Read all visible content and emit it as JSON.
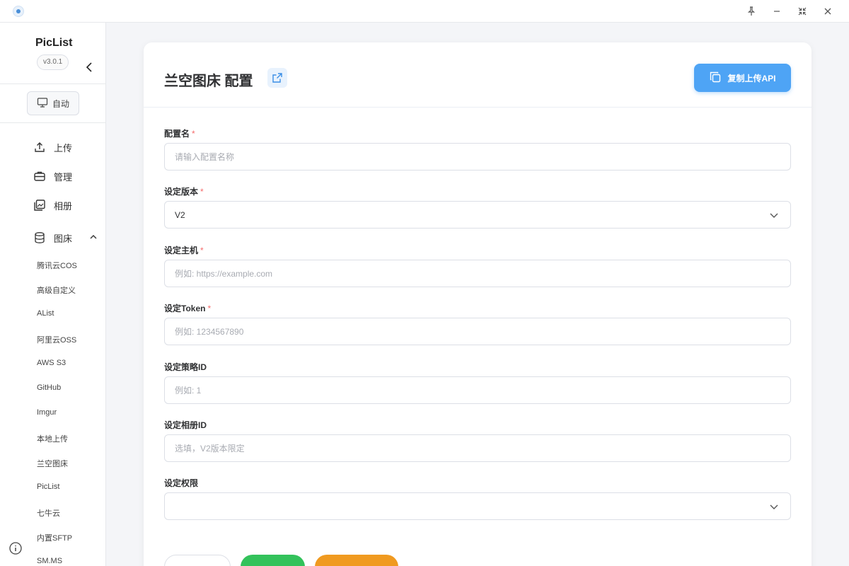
{
  "window": {
    "pin_icon": "pin-icon",
    "minimize_icon": "minimize-icon",
    "restore_icon": "restore-icon",
    "close_icon": "close-icon"
  },
  "sidebar": {
    "app_name": "PicList",
    "version": "v3.0.1",
    "theme_label": "自动",
    "nav": [
      {
        "label": "上传",
        "icon": "upload-icon"
      },
      {
        "label": "管理",
        "icon": "briefcase-icon"
      },
      {
        "label": "相册",
        "icon": "gallery-icon"
      },
      {
        "label": "图床",
        "icon": "database-icon"
      }
    ],
    "hosts": [
      "腾讯云COS",
      "高级自定义",
      "AList",
      "阿里云OSS",
      "AWS S3",
      "GitHub",
      "Imgur",
      "本地上传",
      "兰空图床",
      "PicList",
      "七牛云",
      "内置SFTP",
      "SM.MS"
    ]
  },
  "main": {
    "title": "兰空图床 配置",
    "copy_api_label": "复制上传API",
    "fields": {
      "config_name": {
        "label": "配置名",
        "required": "*",
        "placeholder": "请输入配置名称",
        "value": ""
      },
      "version": {
        "label": "设定版本",
        "required": "*",
        "value": "V2"
      },
      "host": {
        "label": "设定主机",
        "required": "*",
        "placeholder": "例如: https://example.com",
        "value": ""
      },
      "token": {
        "label": "设定Token",
        "required": "*",
        "placeholder": "例如: 1234567890",
        "value": ""
      },
      "strategy_id": {
        "label": "设定策略ID",
        "placeholder": "例如: 1",
        "value": ""
      },
      "album_id": {
        "label": "设定相册ID",
        "placeholder": "选填，V2版本限定",
        "value": ""
      },
      "permission": {
        "label": "设定权限",
        "value": ""
      }
    }
  },
  "colors": {
    "accent": "#4ea4f5",
    "required": "#f56c6c",
    "confirm_button": "#33c25b",
    "secondary_button": "#f09a20"
  }
}
